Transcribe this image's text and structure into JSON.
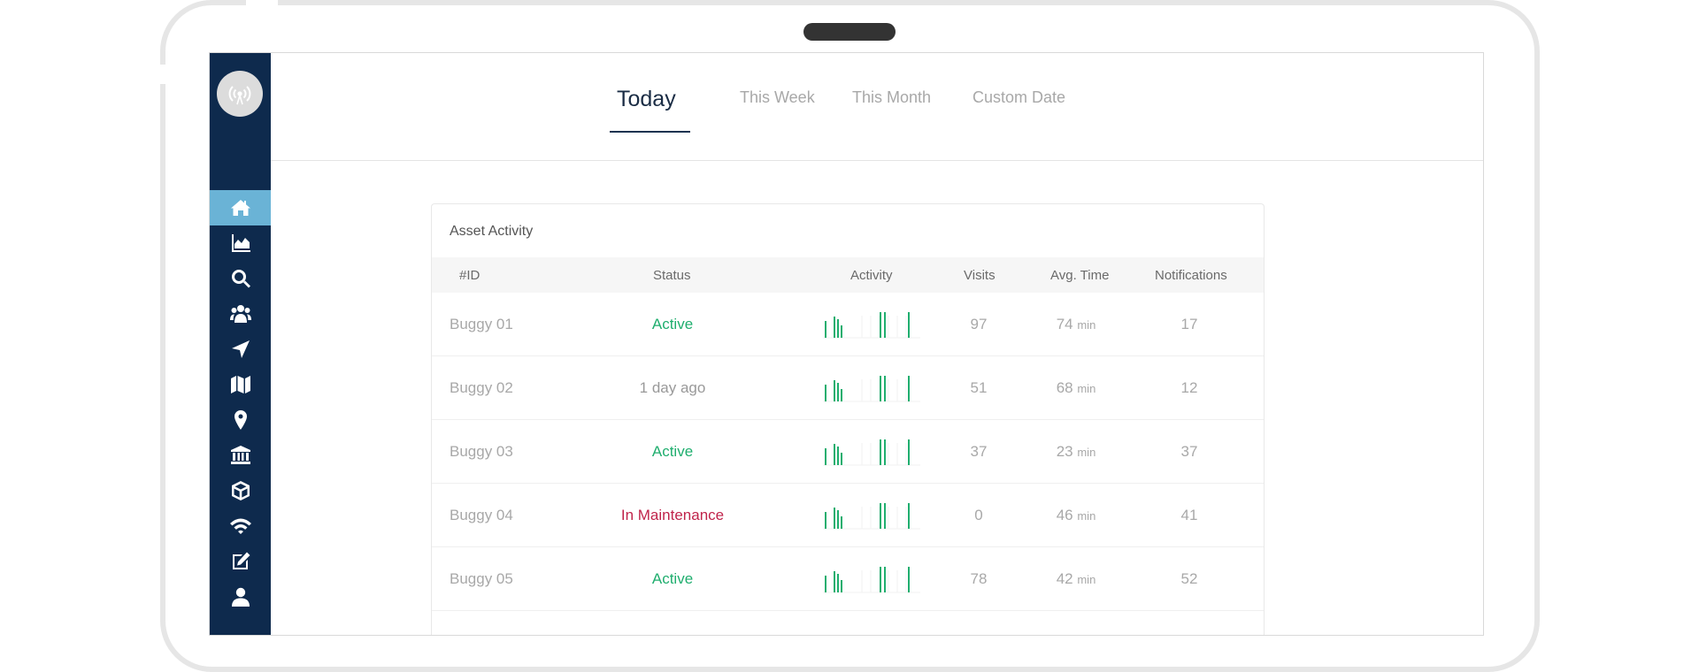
{
  "tabs": [
    {
      "label": "Today",
      "active": true
    },
    {
      "label": "This Week",
      "active": false
    },
    {
      "label": "This Month",
      "active": false
    },
    {
      "label": "Custom Date",
      "active": false
    }
  ],
  "help": {
    "glyph": "?"
  },
  "sidebar": {
    "items": [
      {
        "icon": "home-icon",
        "active": true
      },
      {
        "icon": "area-chart-icon",
        "active": false
      },
      {
        "icon": "search-icon",
        "active": false
      },
      {
        "icon": "users-icon",
        "active": false
      },
      {
        "icon": "location-arrow-icon",
        "active": false
      },
      {
        "icon": "map-icon",
        "active": false
      },
      {
        "icon": "map-marker-icon",
        "active": false
      },
      {
        "icon": "institution-icon",
        "active": false
      },
      {
        "icon": "cube-icon",
        "active": false
      },
      {
        "icon": "wifi-icon",
        "active": false
      },
      {
        "icon": "edit-icon",
        "active": false
      },
      {
        "icon": "user-icon",
        "active": false
      }
    ]
  },
  "card": {
    "title": "Asset Activity",
    "columns": [
      "#ID",
      "Status",
      "Activity",
      "Visits",
      "Avg. Time",
      "Notifications"
    ],
    "rows": [
      {
        "id": "Buggy 01",
        "status": "Active",
        "status_type": "active",
        "visits": "97",
        "avg_time": "74",
        "unit": "min",
        "notifications": "17"
      },
      {
        "id": "Buggy 02",
        "status": "1 day ago",
        "status_type": "idle",
        "visits": "51",
        "avg_time": "68",
        "unit": "min",
        "notifications": "12"
      },
      {
        "id": "Buggy 03",
        "status": "Active",
        "status_type": "active",
        "visits": "37",
        "avg_time": "23",
        "unit": "min",
        "notifications": "37"
      },
      {
        "id": "Buggy 04",
        "status": "In Maintenance",
        "status_type": "maint",
        "visits": "0",
        "avg_time": "46",
        "unit": "min",
        "notifications": "41"
      },
      {
        "id": "Buggy 05",
        "status": "Active",
        "status_type": "active",
        "visits": "78",
        "avg_time": "42",
        "unit": "min",
        "notifications": "52"
      }
    ]
  },
  "colors": {
    "sidebar": "#0e2a4d",
    "sidebar_active": "#6ab3d6",
    "accent_green": "#1fae6e",
    "maintenance_red": "#c0244b"
  }
}
